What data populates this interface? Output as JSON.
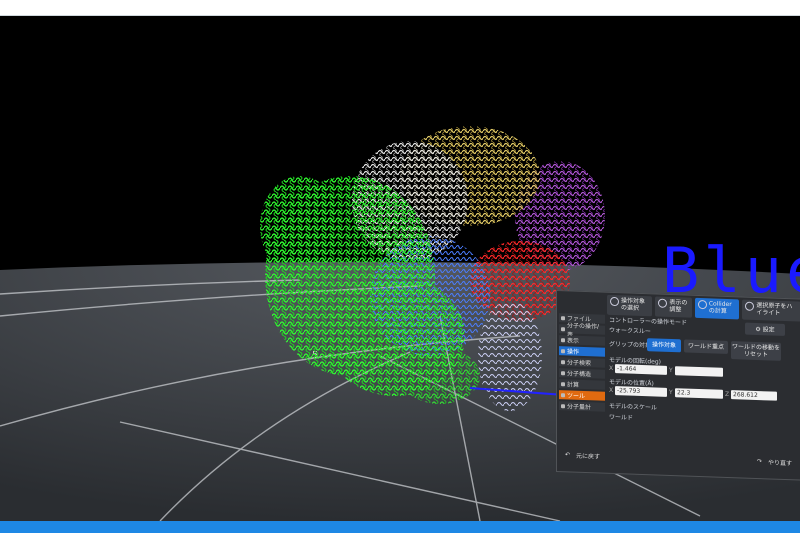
{
  "scene": {
    "overlay_text": "Blue"
  },
  "panel": {
    "tabs": [
      {
        "label": "操作対象の選択",
        "icon": "target-icon"
      },
      {
        "label": "表示の調整",
        "icon": "display-icon"
      },
      {
        "label": "Colliderの計算",
        "icon": "collider-icon"
      },
      {
        "label": "選択原子をハイライト",
        "icon": "highlight-icon"
      }
    ],
    "sidebar": [
      {
        "label": "ファイル",
        "state": "normal"
      },
      {
        "label": "分子の操作/表",
        "state": "normal"
      },
      {
        "label": "表示",
        "state": "normal"
      },
      {
        "label": "操作",
        "state": "active"
      },
      {
        "label": "分子検索",
        "state": "normal"
      },
      {
        "label": "分子構造",
        "state": "normal"
      },
      {
        "label": "計算",
        "state": "normal"
      },
      {
        "label": "ツール",
        "state": "orange"
      },
      {
        "label": "分子量計",
        "state": "normal"
      }
    ],
    "controller_mode_label": "コントローラーの操作モード",
    "walkthrough_label": "ウォークスルー",
    "settings_label": "設定",
    "grip_target_label": "グリップの対象",
    "grip_buttons": [
      "操作対象",
      "ワールド重点",
      "ワールドの移動をリセット"
    ],
    "rotation_label": "モデルの回転(deg)",
    "rotation": {
      "x": "-1.464",
      "y": "",
      "z": ""
    },
    "position_label": "モデルの位置(Å)",
    "position": {
      "x": "-25.793",
      "y": "22.3",
      "z": "268.612"
    },
    "scale_label": "モデルのスケール",
    "world_label": "ワールド",
    "undo_label": "元に戻す",
    "redo_label": "やり直す"
  },
  "colors": {
    "accent": "#1f6fd1",
    "tool_highlight": "#e06a10",
    "overlay_text": "#1a1aff",
    "bottom_bar": "#1e88e5"
  }
}
